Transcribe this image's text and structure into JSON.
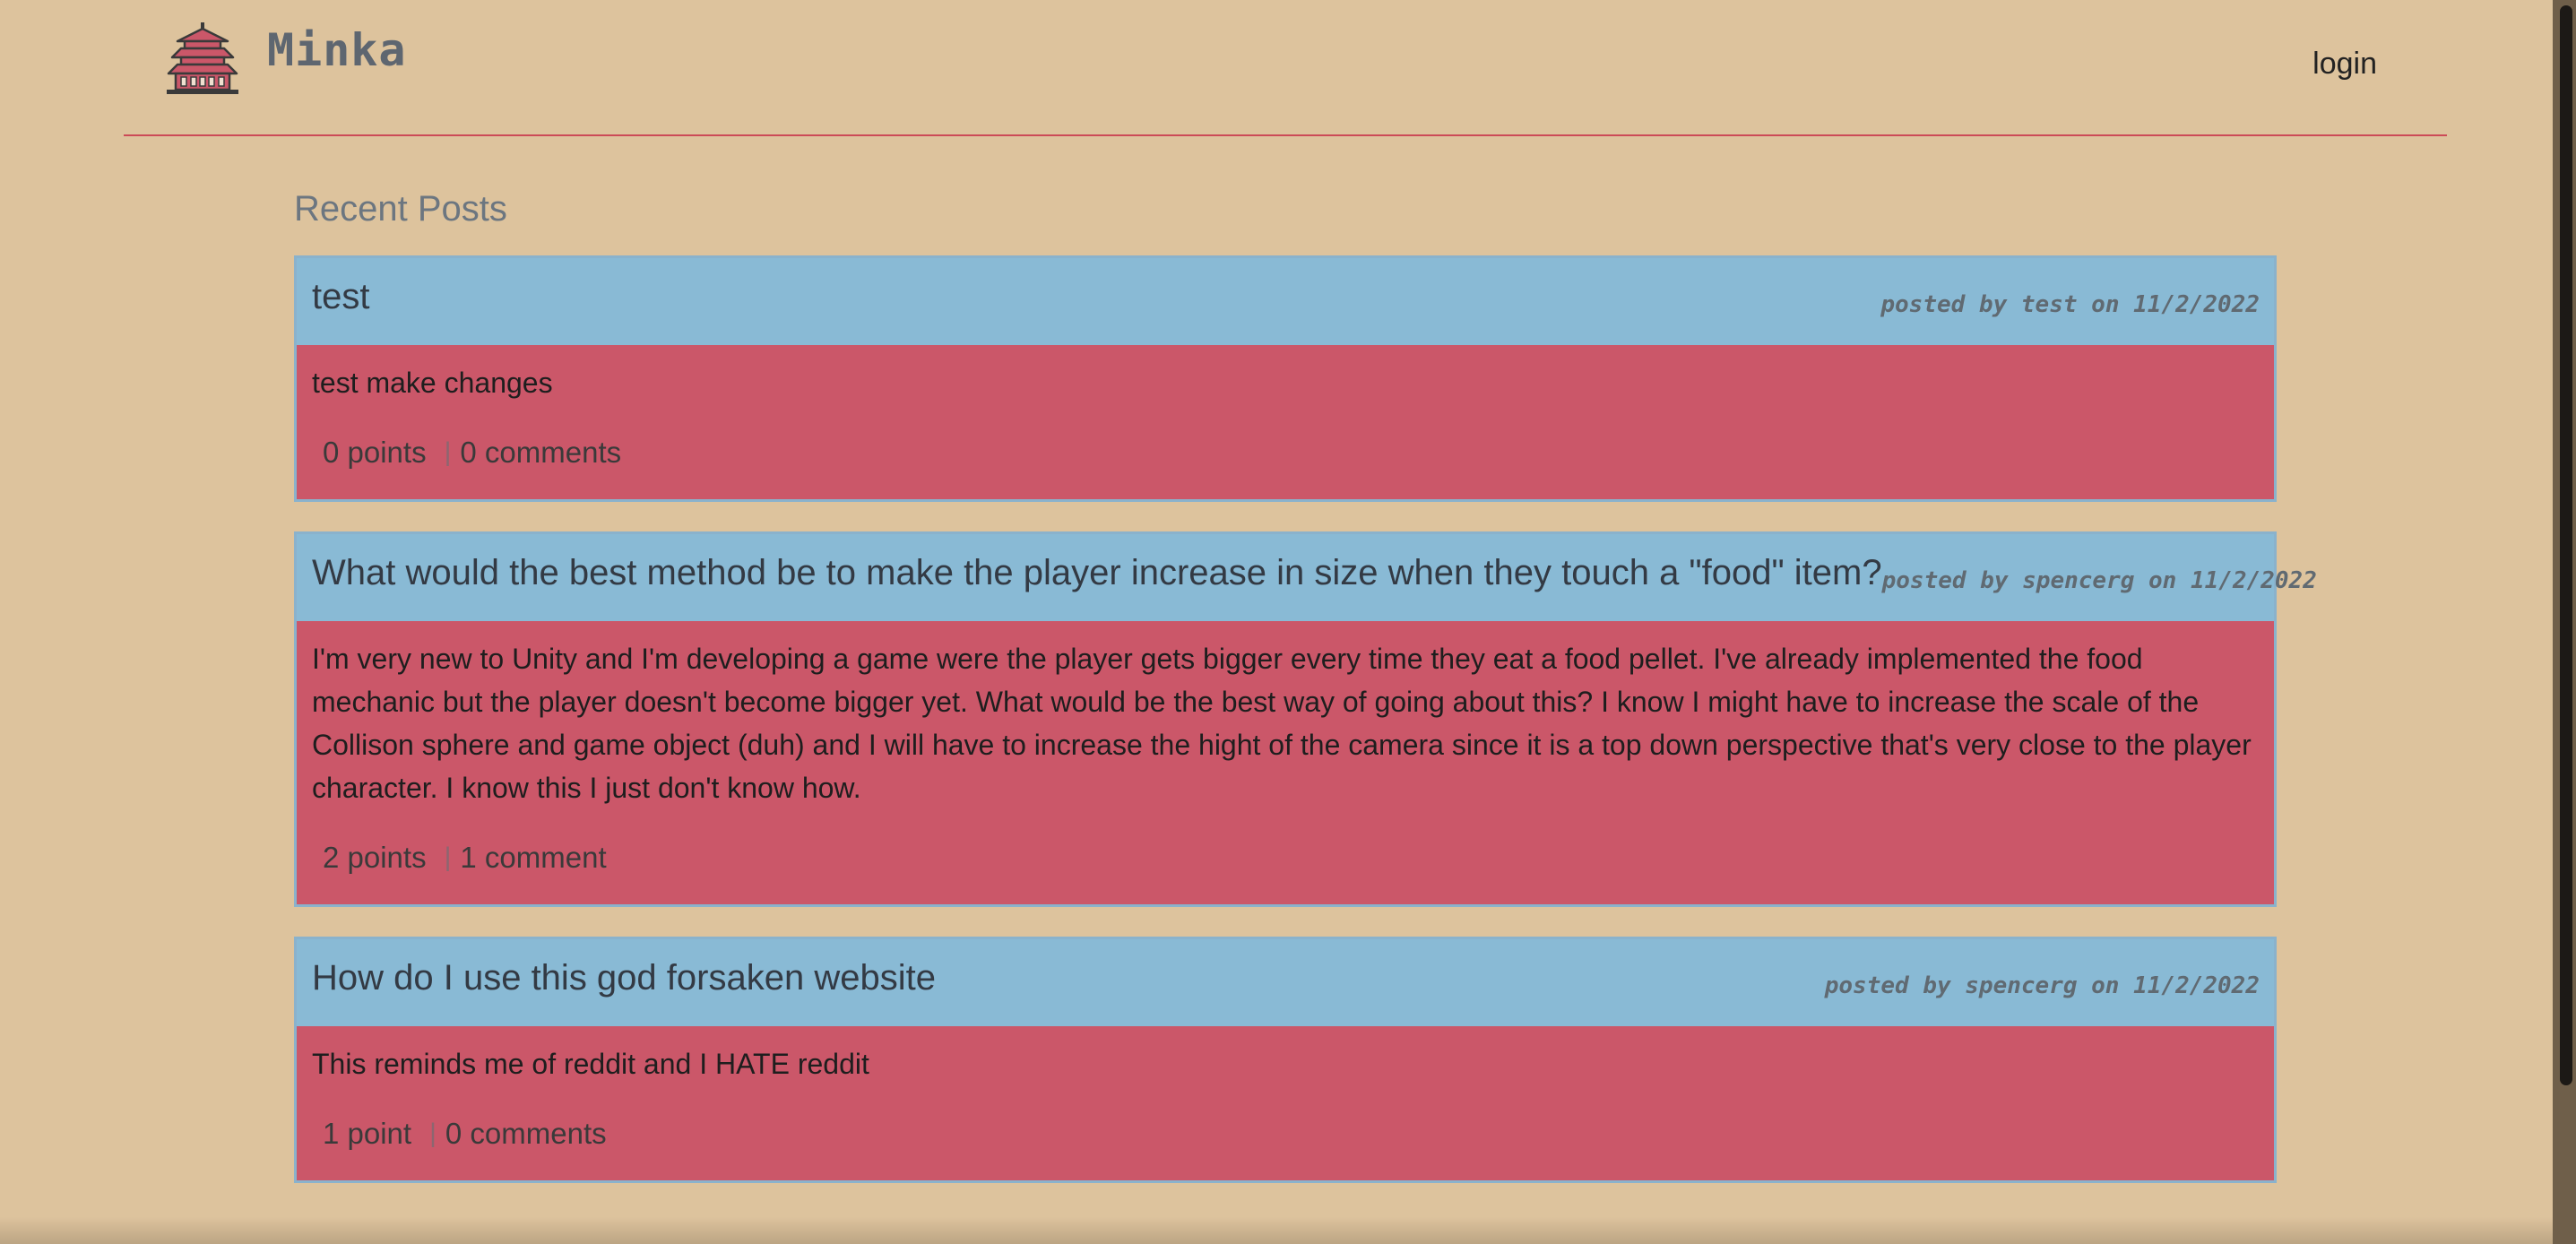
{
  "header": {
    "brand_name": "Minka",
    "logo_icon": "pagoda-icon",
    "login_label": "login"
  },
  "main": {
    "section_title": "Recent Posts",
    "posts": [
      {
        "title": "test",
        "meta": "posted by test on 11/2/2022",
        "body": "test make changes",
        "points": "0 points",
        "comments": "0 comments"
      },
      {
        "title": "What would the best method be to make the player increase in size when they touch a \"food\" item?",
        "meta": "posted by spencerg on 11/2/2022",
        "body": "I'm very new to Unity and I'm developing a game were the player gets bigger every time they eat a food pellet. I've already implemented the food mechanic but the player doesn't become bigger yet. What would be the best way of going about this? I know I might have to increase the scale of the Collison sphere and game object (duh) and I will have to increase the hight of the camera since it is a top down perspective that's very close to the player character. I know this I just don't know how.",
        "points": "2 points",
        "comments": "1 comment"
      },
      {
        "title": "How do I use this god forsaken website",
        "meta": "posted by spencerg on 11/2/2022",
        "body": "This reminds me of reddit and I HATE reddit",
        "points": "1 point",
        "comments": "0 comments"
      }
    ],
    "stat_separator": "|"
  },
  "colors": {
    "page_background": "#ddc39d",
    "post_header": "#89bad5",
    "post_body": "#cb5769",
    "navbar_rule": "#cc4a57"
  }
}
